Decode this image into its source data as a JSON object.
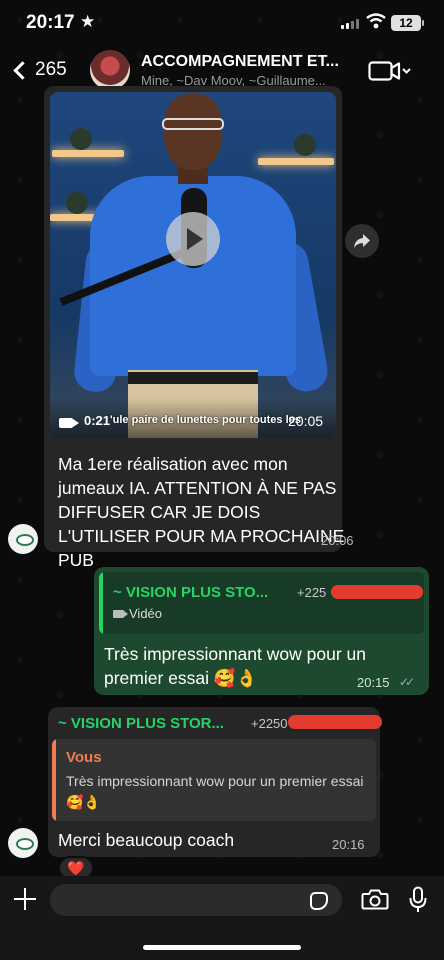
{
  "status_bar": {
    "time": "20:17",
    "star": "★",
    "battery": "12"
  },
  "header": {
    "back_count": "265",
    "title": "ACCOMPAGNEMENT ET...",
    "members": "Mine, ~Dav Moov, ~Guillaume..."
  },
  "video_message": {
    "caption": "'ule paire de lunettes pour toutes les",
    "duration": "0:21",
    "time": "20:05"
  },
  "message1": {
    "text": "Ma 1ere réalisation avec mon jumeaux IA. ATTENTION À NE PAS DIFFUSER CAR JE DOIS L'UTILISER POUR MA PROCHAINE PUB",
    "time": "20:06"
  },
  "message2": {
    "quote_sender": "~ VISION PLUS STO...",
    "quote_phone": "+225",
    "quote_type": "Vidéo",
    "text": "Très impressionnant wow pour un premier essai 🥰👌",
    "time": "20:15",
    "ticks": "✓✓"
  },
  "message3": {
    "sender": "~ VISION PLUS STOR...",
    "phone": "+2250",
    "quote_sender": "Vous",
    "quote_text": "Très impressionnant wow pour un premier essai 🥰👌",
    "text": "Merci beaucoup coach",
    "time": "20:16",
    "reaction": "❤️"
  },
  "colors": {
    "outgoing_bubble": "#1d4a2f",
    "incoming_bubble": "#262626",
    "accent_green": "#25d366",
    "quote_orange": "#f07c52"
  },
  "icons": [
    "star-icon",
    "signal-icon",
    "wifi-icon",
    "battery-icon",
    "back-chevron-icon",
    "video-call-icon",
    "play-icon",
    "forward-icon",
    "video-camera-icon",
    "read-ticks-icon",
    "plus-icon",
    "sticker-icon",
    "camera-icon",
    "microphone-icon"
  ]
}
